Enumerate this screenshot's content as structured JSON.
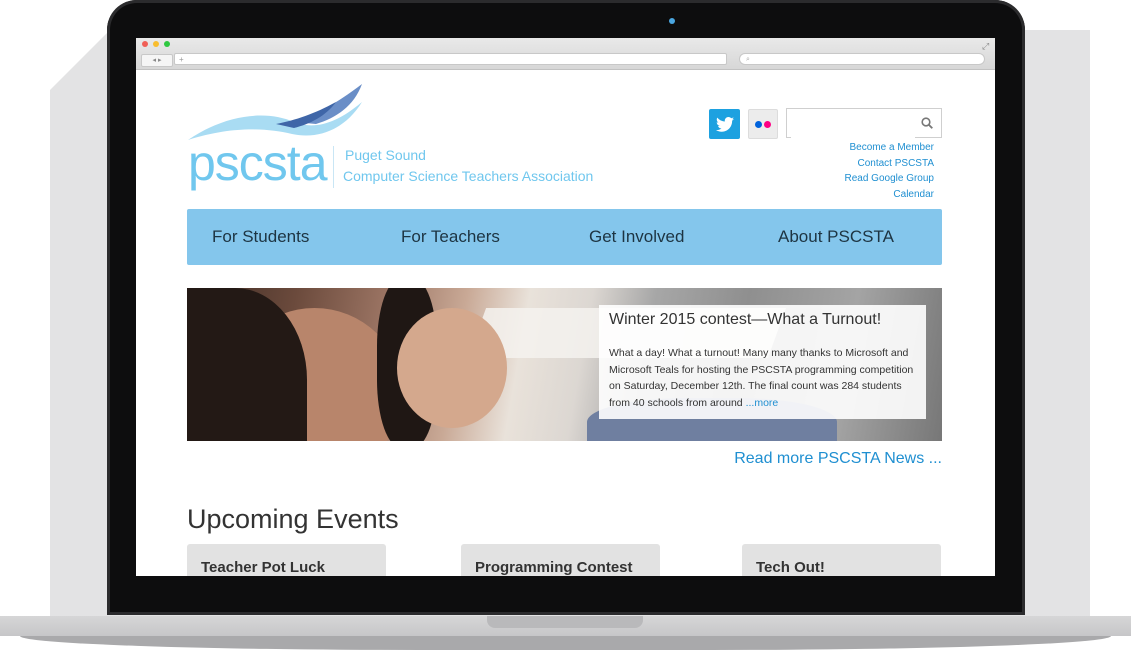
{
  "browser": {
    "url": "+",
    "search_placeholder": "⌕"
  },
  "site": {
    "logo_text": "pscsta",
    "tagline_line1": "Puget Sound",
    "tagline_line2": "Computer Science Teachers Association",
    "brand_color": "#70c7ee"
  },
  "social": {
    "twitter_icon": "twitter-bird-icon",
    "flickr_icon": "flickr-dots-icon"
  },
  "search": {
    "placeholder": ""
  },
  "quick_links": [
    "Become a Member",
    "Contact PSCSTA",
    "Read Google Group",
    "Calendar"
  ],
  "nav": {
    "color": "#84c6ec",
    "items": [
      "For Students",
      "For Teachers",
      "Get Involved",
      "About PSCSTA"
    ]
  },
  "hero": {
    "title": "Winter 2015 contest—What a Turnout!",
    "body": "What a day! What a turnout! Many many thanks to Microsoft and Microsoft Teals for hosting the PSCSTA programming competition on Saturday, December 12th. The final count was 284 students from 40 schools from around",
    "more_label": "...more"
  },
  "news_link": "Read more PSCSTA News ...",
  "events": {
    "heading": "Upcoming Events",
    "items": [
      "Teacher Pot Luck",
      "Programming Contest",
      "Tech Out!"
    ]
  }
}
